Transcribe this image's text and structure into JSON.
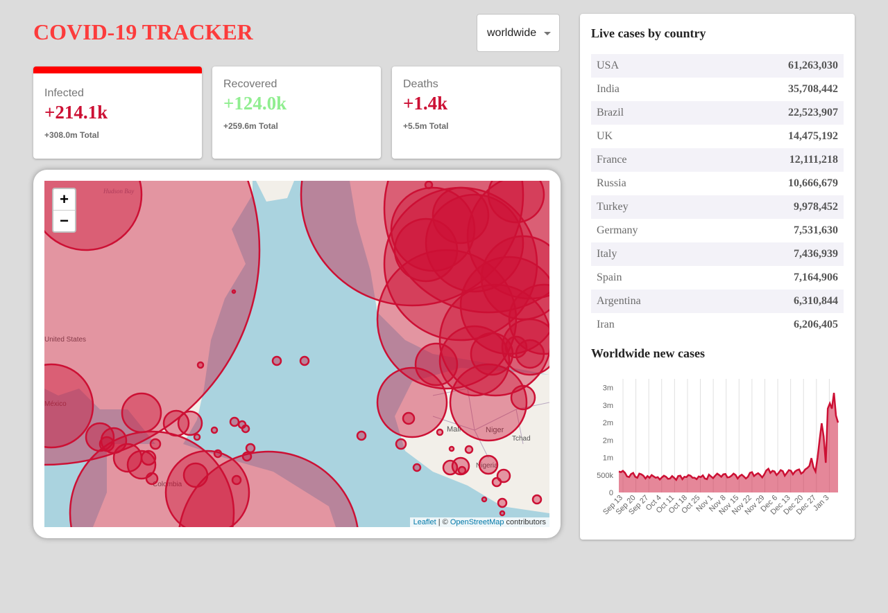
{
  "header": {
    "title": "COVID-19 TRACKER"
  },
  "country_select": {
    "selected": "worldwide"
  },
  "stat_cards": [
    {
      "label": "Infected",
      "value": "+214.1k",
      "total": "+308.0m Total",
      "color": "#cc1034",
      "selected": true
    },
    {
      "label": "Recovered",
      "value": "+124.0k",
      "total": "+259.6m Total",
      "color": "#7dd71d",
      "selected": false
    },
    {
      "label": "Deaths",
      "value": "+1.4k",
      "total": "+5.5m Total",
      "color": "#cc1034",
      "selected": false
    }
  ],
  "map": {
    "zoom_in": "+",
    "zoom_out": "−",
    "attribution": {
      "leaflet": "Leaflet",
      "separator": " | © ",
      "osm": "OpenStreetMap",
      "suffix": " contributors"
    },
    "labels": {
      "hudson_bay": "Hudson Bay",
      "united_states": "United States",
      "mexico": "México",
      "colombia": "Colombia",
      "mali": "Mali",
      "niger": "Niger",
      "tchad": "Tchad",
      "nigeria": "Nigeria"
    },
    "circle_color": "#cc1034"
  },
  "table": {
    "title": "Live cases by country",
    "rows": [
      {
        "country": "USA",
        "cases": "61,263,030"
      },
      {
        "country": "India",
        "cases": "35,708,442"
      },
      {
        "country": "Brazil",
        "cases": "22,523,907"
      },
      {
        "country": "UK",
        "cases": "14,475,192"
      },
      {
        "country": "France",
        "cases": "12,111,218"
      },
      {
        "country": "Russia",
        "cases": "10,666,679"
      },
      {
        "country": "Turkey",
        "cases": "9,978,452"
      },
      {
        "country": "Germany",
        "cases": "7,531,630"
      },
      {
        "country": "Italy",
        "cases": "7,436,939"
      },
      {
        "country": "Spain",
        "cases": "7,164,906"
      },
      {
        "country": "Argentina",
        "cases": "6,310,844"
      },
      {
        "country": "Iran",
        "cases": "6,206,405"
      }
    ]
  },
  "chart_title": "Worldwide new cases",
  "chart_data": {
    "type": "area",
    "color": "#cc1034",
    "fill": "rgba(204,16,52,0.5)",
    "ylim": [
      0,
      3250000
    ],
    "ytick_values": [
      0,
      500000,
      1000000,
      1500000,
      2000000,
      2500000,
      3000000
    ],
    "ytick_labels": [
      "0",
      "500k",
      "1m",
      "2m",
      "2m",
      "3m",
      "3m"
    ],
    "xtick_labels": [
      "Sep 13",
      "Sep 20",
      "Sep 27",
      "Oct 4",
      "Oct 11",
      "Oct 18",
      "Oct 25",
      "Nov 1",
      "Nov 8",
      "Nov 15",
      "Nov 22",
      "Nov 29",
      "Dec 6",
      "Dec 13",
      "Dec 20",
      "Dec 27",
      "Jan 3"
    ],
    "values": [
      600000,
      580000,
      620000,
      560000,
      460000,
      440000,
      530000,
      560000,
      450000,
      420000,
      540000,
      520000,
      480000,
      400000,
      470000,
      420000,
      500000,
      460000,
      420000,
      440000,
      370000,
      430000,
      480000,
      450000,
      390000,
      400000,
      470000,
      420000,
      360000,
      470000,
      480000,
      380000,
      450000,
      440000,
      500000,
      480000,
      420000,
      420000,
      380000,
      460000,
      440000,
      490000,
      400000,
      380000,
      510000,
      460000,
      410000,
      480000,
      540000,
      500000,
      450000,
      520000,
      530000,
      430000,
      440000,
      480000,
      540000,
      500000,
      400000,
      470000,
      510000,
      460000,
      400000,
      450000,
      560000,
      580000,
      470000,
      520000,
      550000,
      500000,
      430000,
      520000,
      630000,
      680000,
      560000,
      620000,
      600000,
      500000,
      560000,
      640000,
      610000,
      480000,
      560000,
      640000,
      620000,
      520000,
      600000,
      640000,
      660000,
      540000,
      580000,
      660000,
      700000,
      760000,
      980000,
      720000,
      600000,
      1000000,
      1500000,
      1980000,
      1600000,
      850000,
      2400000,
      2550000,
      2400000,
      2850000,
      2200000,
      2000000
    ]
  }
}
